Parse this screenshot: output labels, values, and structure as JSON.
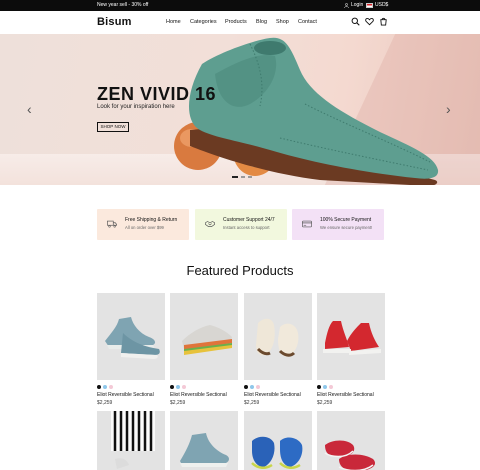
{
  "topbar": {
    "promo": "New year sell - 30% off",
    "login": "Login",
    "currency": "USD$"
  },
  "header": {
    "logo": "Bisum",
    "nav": [
      "Home",
      "Categories",
      "Products",
      "Blog",
      "Shop",
      "Contact"
    ],
    "icons": [
      "search-icon",
      "heart-icon",
      "cart-icon"
    ]
  },
  "hero": {
    "title": "ZEN VIVID 16",
    "subtitle": "Look for your inspiration here",
    "button": "SHOP NOW",
    "slides": 3,
    "active_slide": 1
  },
  "features": [
    {
      "title": "Free Shipping & Return",
      "subtitle": "All on order over $99",
      "icon": "truck-icon",
      "color": "#fbe9dd"
    },
    {
      "title": "Customer Support 24/7",
      "subtitle": "Instant access to support",
      "icon": "handshake-icon",
      "color": "#f2f8de"
    },
    {
      "title": "100% Secure Payment",
      "subtitle": "We ensure secure payment!",
      "icon": "card-icon",
      "color": "#f3e1f6"
    }
  ],
  "featured": {
    "title": "Featured Products",
    "products": [
      {
        "name": "Eliot Reversible Sectional",
        "price": "$2,259",
        "swatches": [
          "#111111",
          "#8fc7ea",
          "#f4c9d6"
        ]
      },
      {
        "name": "Eliot Reversible Sectional",
        "price": "$2,259",
        "swatches": [
          "#111111",
          "#8fc7ea",
          "#f4c9d6"
        ]
      },
      {
        "name": "Eliot Reversible Sectional",
        "price": "$2,259",
        "swatches": [
          "#111111",
          "#8fc7ea",
          "#f4c9d6"
        ]
      },
      {
        "name": "Eliot Reversible Sectional",
        "price": "$2,259",
        "swatches": [
          "#111111",
          "#8fc7ea",
          "#f4c9d6"
        ]
      }
    ]
  }
}
